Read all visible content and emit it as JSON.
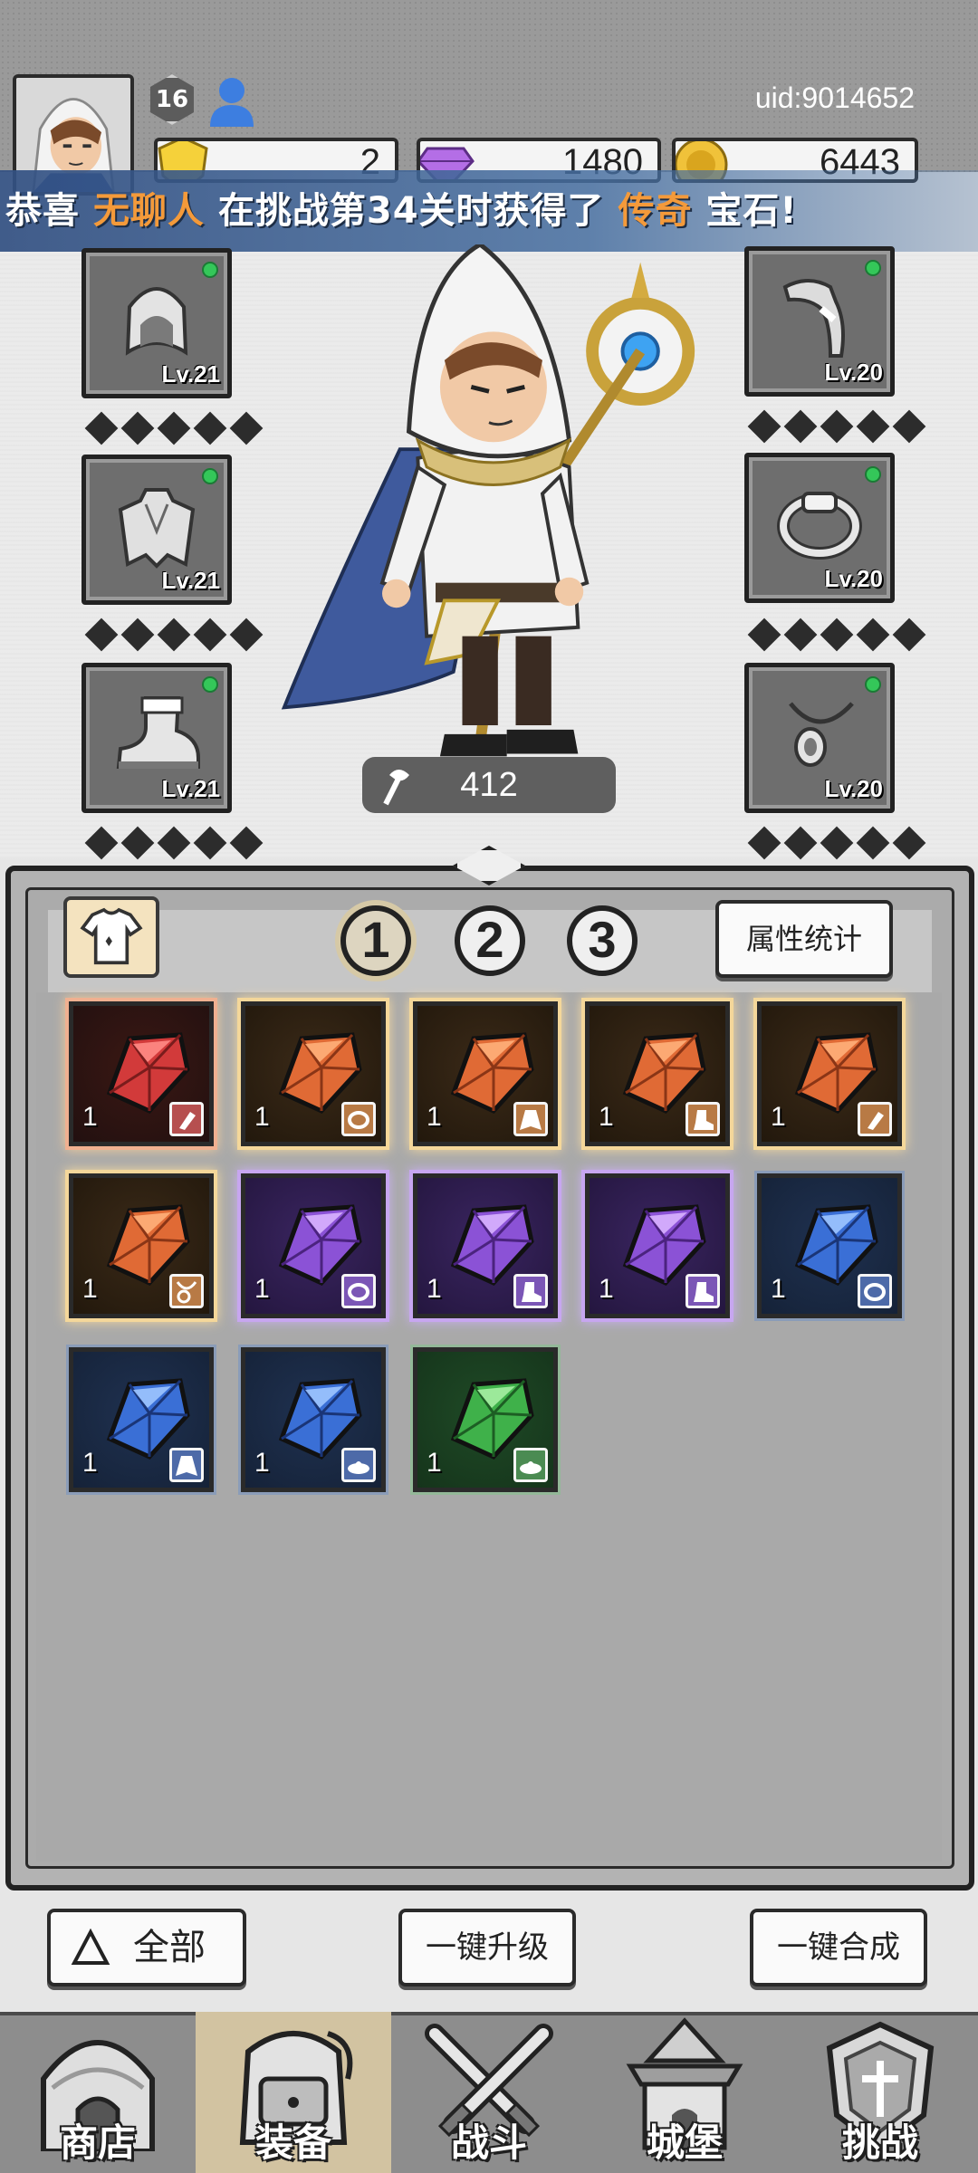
{
  "header": {
    "uid": "uid:9014652",
    "level": "16",
    "currencies": [
      {
        "name": "energy",
        "value": "2",
        "icon": "shield-gem-icon"
      },
      {
        "name": "diamond",
        "value": "1480",
        "icon": "diamond-icon"
      },
      {
        "name": "gold",
        "value": "6443",
        "icon": "gold-coin-icon"
      }
    ]
  },
  "announcement": {
    "prefix": "恭喜",
    "player": "无聊人",
    "middle": "在挑战第34关时获得了",
    "rarity": "传奇",
    "suffix": "宝石!"
  },
  "equipment": {
    "left": [
      {
        "slot": "hood",
        "level": "Lv.21"
      },
      {
        "slot": "cloak",
        "level": "Lv.21"
      },
      {
        "slot": "boots",
        "level": "Lv.21"
      }
    ],
    "right": [
      {
        "slot": "weapon",
        "level": "Lv.20"
      },
      {
        "slot": "ring",
        "level": "Lv.20"
      },
      {
        "slot": "necklace",
        "level": "Lv.20"
      }
    ]
  },
  "hero": {
    "power": "412"
  },
  "inventory": {
    "tabs": [
      "1",
      "2",
      "3"
    ],
    "active_tab": 0,
    "stats_label": "属性统计",
    "gems": [
      {
        "rarity": "red",
        "qty": "1",
        "slot": "weapon"
      },
      {
        "rarity": "orange",
        "qty": "1",
        "slot": "ring"
      },
      {
        "rarity": "orange",
        "qty": "1",
        "slot": "cloak"
      },
      {
        "rarity": "orange",
        "qty": "1",
        "slot": "boots"
      },
      {
        "rarity": "orange",
        "qty": "1",
        "slot": "weapon"
      },
      {
        "rarity": "orange",
        "qty": "1",
        "slot": "necklace"
      },
      {
        "rarity": "purple",
        "qty": "1",
        "slot": "ring"
      },
      {
        "rarity": "purple",
        "qty": "1",
        "slot": "boots"
      },
      {
        "rarity": "purple",
        "qty": "1",
        "slot": "boots"
      },
      {
        "rarity": "blue",
        "qty": "1",
        "slot": "ring"
      },
      {
        "rarity": "blue",
        "qty": "1",
        "slot": "cloak"
      },
      {
        "rarity": "blue",
        "qty": "1",
        "slot": "hat"
      },
      {
        "rarity": "green",
        "qty": "1",
        "slot": "hat"
      }
    ]
  },
  "actions": {
    "filter_all": "全部",
    "upgrade_all": "一键升级",
    "merge_all": "一键合成"
  },
  "nav": [
    {
      "label": "商店",
      "icon": "shop-icon",
      "active": false
    },
    {
      "label": "装备",
      "icon": "backpack-icon",
      "active": true
    },
    {
      "label": "战斗",
      "icon": "crossed-swords-icon",
      "active": false
    },
    {
      "label": "城堡",
      "icon": "castle-icon",
      "active": false
    },
    {
      "label": "挑战",
      "icon": "challenge-shield-icon",
      "active": false
    }
  ],
  "colors": {
    "rarity_red": "#b64f4f",
    "rarity_orange": "#d7783f",
    "rarity_purple": "#8b5fd0",
    "rarity_blue": "#3e68c4",
    "rarity_green": "#3fa34d",
    "highlight": "#f49a3a",
    "online_dot": "#34c759"
  }
}
